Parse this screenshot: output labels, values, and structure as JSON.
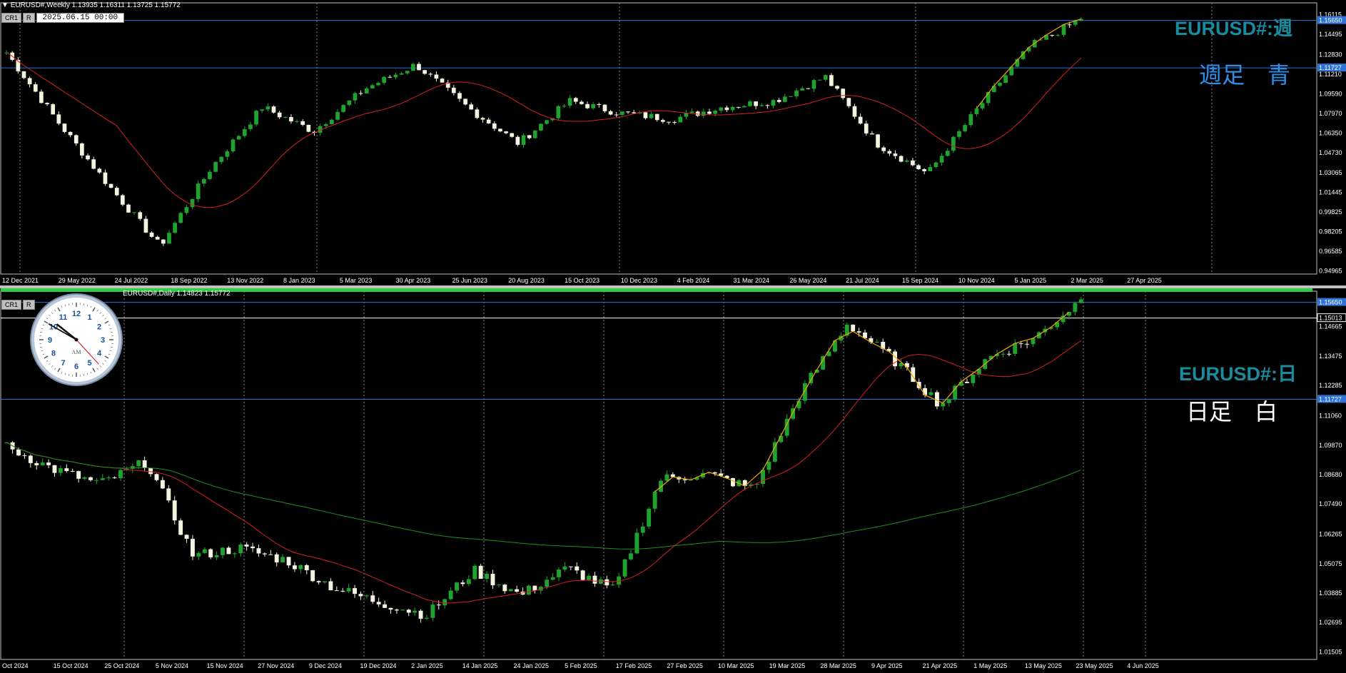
{
  "colors": {
    "up": "#1fa32f",
    "down": "#f3f3e0",
    "ma_fast": "#d42020",
    "ma_slow": "#1e8e1e",
    "zigzag": "#f2a800",
    "hline": "#2e74d8",
    "hline_white": "#ffffff",
    "grid": "#8a8a8a",
    "title": "#1a8a9e"
  },
  "top_pane": {
    "header": "EURUSD#,Weekly  1.13935 1.16311 1.13725 1.15772",
    "ctrl_labels": [
      "CR1",
      "R"
    ],
    "date_box": "2025.06.15 00:00",
    "title": "EURUSD#:週",
    "note": "週足　青",
    "price_axis": [
      "1.16115",
      "1.14495",
      "1.12830",
      "1.11210",
      "1.09590",
      "1.07970",
      "1.06350",
      "1.04730",
      "1.03065",
      "1.01445",
      "0.99825",
      "0.98205",
      "0.96585",
      "0.94965"
    ],
    "hline_labels": [
      "1.15650",
      "1.11727"
    ]
  },
  "bottom_pane": {
    "header": "EURUSD#,Daily  1.14823 1.15772",
    "ctrl_labels": [
      "CR1",
      "R"
    ],
    "title": "EURUSD#:日",
    "note": "日足　白",
    "price_axis": [
      "1.14665",
      "1.13475",
      "1.12285",
      "1.11060",
      "1.09870",
      "1.08680",
      "1.07490",
      "1.06265",
      "1.05075",
      "1.03885",
      "1.02695",
      "1.01505"
    ],
    "hline_labels": [
      "1.15650",
      "1.15013",
      "1.11727"
    ]
  },
  "clock": {
    "label": "AM",
    "numbers": [
      "12",
      "1",
      "2",
      "3",
      "4",
      "5",
      "6",
      "7",
      "8",
      "9",
      "10",
      "11"
    ]
  },
  "chart_data": [
    {
      "type": "candlestick",
      "timeframe": "Weekly",
      "symbol": "EURUSD#",
      "x_labels": [
        "12 Dec 2021",
        "29 May 2022",
        "24 Jul 2022",
        "18 Sep 2022",
        "13 Nov 2022",
        "8 Jan 2023",
        "5 Mar 2023",
        "30 Apr 2023",
        "25 Jun 2023",
        "20 Aug 2023",
        "15 Oct 2023",
        "10 Dec 2023",
        "4 Feb 2024",
        "31 Mar 2024",
        "26 May 2024",
        "21 Jul 2024",
        "15 Sep 2024",
        "10 Nov 2024",
        "5 Jan 2025",
        "2 Mar 2025",
        "27 Apr 2025"
      ],
      "ylim": [
        0.947,
        1.171
      ],
      "ohlc_last": [
        1.13935,
        1.16311,
        1.13725,
        1.15772
      ],
      "key_closes": [
        {
          "x": "12 Dec 2021",
          "close": 1.13
        },
        {
          "x": "29 May 2022",
          "close": 1.073
        },
        {
          "x": "24 Jul 2022",
          "close": 1.02
        },
        {
          "x": "18 Sep 2022",
          "close": 0.97
        },
        {
          "x": "13 Nov 2022",
          "close": 1.035
        },
        {
          "x": "8 Jan 2023",
          "close": 1.085
        },
        {
          "x": "5 Mar 2023",
          "close": 1.065
        },
        {
          "x": "30 Apr 2023",
          "close": 1.1
        },
        {
          "x": "25 Jun 2023",
          "close": 1.12
        },
        {
          "x": "20 Aug 2023",
          "close": 1.085
        },
        {
          "x": "15 Oct 2023",
          "close": 1.055
        },
        {
          "x": "10 Dec 2023",
          "close": 1.09
        },
        {
          "x": "4 Feb 2024",
          "close": 1.08
        },
        {
          "x": "31 Mar 2024",
          "close": 1.075
        },
        {
          "x": "26 May 2024",
          "close": 1.085
        },
        {
          "x": "21 Jul 2024",
          "close": 1.09
        },
        {
          "x": "15 Sep 2024",
          "close": 1.11
        },
        {
          "x": "10 Nov 2024",
          "close": 1.055
        },
        {
          "x": "5 Jan 2025",
          "close": 1.03
        },
        {
          "x": "2 Mar 2025",
          "close": 1.085
        },
        {
          "x": "27 Apr 2025",
          "close": 1.135
        },
        {
          "x": "last",
          "close": 1.1577
        }
      ],
      "hlines": [
        1.1565,
        1.11727
      ]
    },
    {
      "type": "candlestick",
      "timeframe": "Daily",
      "symbol": "EURUSD#",
      "x_labels": [
        "Oct 2024",
        "15 Oct 2024",
        "25 Oct 2024",
        "5 Nov 2024",
        "15 Nov 2024",
        "27 Nov 2024",
        "9 Dec 2024",
        "19 Dec 2024",
        "2 Jan 2025",
        "14 Jan 2025",
        "24 Jan 2025",
        "5 Feb 2025",
        "17 Feb 2025",
        "27 Feb 2025",
        "10 Mar 2025",
        "19 Mar 2025",
        "28 Mar 2025",
        "9 Apr 2025",
        "21 Apr 2025",
        "1 May 2025",
        "13 May 2025",
        "23 May 2025",
        "4 Jun 2025"
      ],
      "ylim": [
        1.012,
        1.161
      ],
      "key_closes": [
        {
          "x": "Oct 2024",
          "close": 1.098
        },
        {
          "x": "15 Oct 2024",
          "close": 1.089
        },
        {
          "x": "25 Oct 2024",
          "close": 1.083
        },
        {
          "x": "5 Nov 2024",
          "close": 1.092
        },
        {
          "x": "15 Nov 2024",
          "close": 1.054
        },
        {
          "x": "27 Nov 2024",
          "close": 1.057
        },
        {
          "x": "9 Dec 2024",
          "close": 1.052
        },
        {
          "x": "19 Dec 2024",
          "close": 1.041
        },
        {
          "x": "2 Jan 2025",
          "close": 1.035
        },
        {
          "x": "14 Jan 2025",
          "close": 1.03
        },
        {
          "x": "24 Jan 2025",
          "close": 1.048
        },
        {
          "x": "5 Feb 2025",
          "close": 1.038
        },
        {
          "x": "17 Feb 2025",
          "close": 1.049
        },
        {
          "x": "27 Feb 2025",
          "close": 1.04
        },
        {
          "x": "10 Mar 2025",
          "close": 1.085
        },
        {
          "x": "19 Mar 2025",
          "close": 1.087
        },
        {
          "x": "28 Mar 2025",
          "close": 1.081
        },
        {
          "x": "9 Apr 2025",
          "close": 1.12
        },
        {
          "x": "21 Apr 2025",
          "close": 1.148
        },
        {
          "x": "1 May 2025",
          "close": 1.133
        },
        {
          "x": "13 May 2025",
          "close": 1.115
        },
        {
          "x": "23 May 2025",
          "close": 1.134
        },
        {
          "x": "4 Jun 2025",
          "close": 1.142
        },
        {
          "x": "last",
          "close": 1.1577
        }
      ],
      "hlines": [
        1.1565,
        1.15013,
        1.11727
      ]
    }
  ]
}
